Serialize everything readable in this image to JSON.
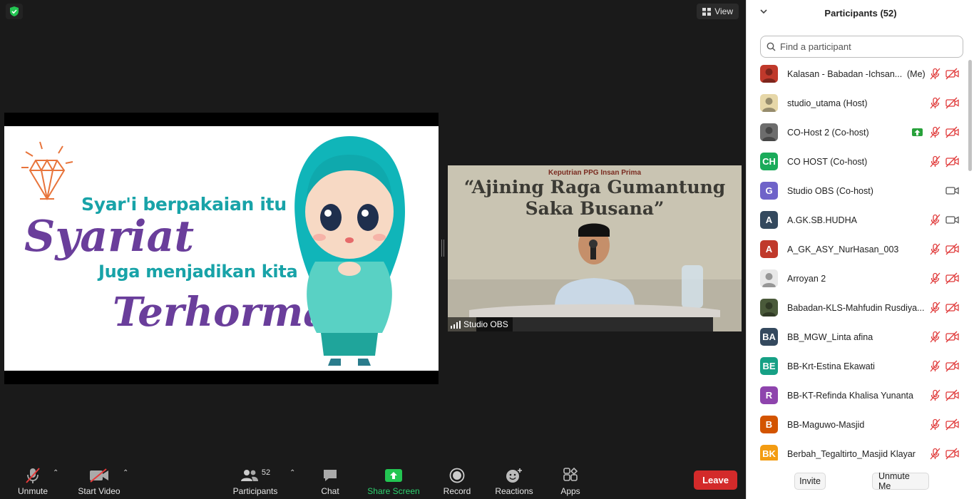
{
  "view_button": {
    "label": "View",
    "icon": "grid-icon"
  },
  "shared_slide": {
    "line1": "Syar'i berpakaian itu",
    "word1": "Syariat",
    "line2": "Juga menjadikan kita",
    "word2": "Terhormat"
  },
  "camera_tile": {
    "banner_small": "Keputrian PPG Insan Prima",
    "banner_line1": "“Ajining Raga Gumantung",
    "banner_line2": "Saka Busana”",
    "name": "Studio OBS"
  },
  "toolbar": {
    "unmute": "Unmute",
    "start_video": "Start Video",
    "participants": "Participants",
    "participants_count": "52",
    "chat": "Chat",
    "share_screen": "Share Screen",
    "record": "Record",
    "reactions": "Reactions",
    "apps": "Apps",
    "leave": "Leave"
  },
  "panel": {
    "title": "Participants (52)",
    "search_placeholder": "Find a participant",
    "invite": "Invite",
    "unmute_me": "Unmute Me",
    "participants": [
      {
        "name": "Kalasan - Babadan -Ichsan...",
        "me": "(Me)",
        "avatar": "",
        "color": "#c0392b",
        "photo": true,
        "mic": "muted",
        "video": "off"
      },
      {
        "name": "studio_utama (Host)",
        "avatar": "",
        "color": "#e6d7a8",
        "photo": true,
        "mic": "muted",
        "video": "off"
      },
      {
        "name": "CO-Host 2 (Co-host)",
        "avatar": "",
        "color": "#6d6d6d",
        "photo": true,
        "share": true,
        "mic": "muted",
        "video": "off"
      },
      {
        "name": "CO HOST (Co-host)",
        "avatar": "CH",
        "color": "#1aab5a",
        "mic": "muted",
        "video": "off"
      },
      {
        "name": "Studio OBS (Co-host)",
        "avatar": "G",
        "color": "#6f63c9",
        "mic": "none",
        "video": "on"
      },
      {
        "name": "A.GK.SB.HUDHA",
        "avatar": "A",
        "color": "#34495e",
        "mic": "muted",
        "video": "on"
      },
      {
        "name": "A_GK_ASY_NurHasan_003",
        "avatar": "A",
        "color": "#c0392b",
        "mic": "muted",
        "video": "off"
      },
      {
        "name": "Arroyan 2",
        "avatar": "",
        "color": "#e8e8e8",
        "photo": true,
        "mic": "muted",
        "video": "off"
      },
      {
        "name": "Babadan-KLS-Mahfudin Rusdiya...",
        "avatar": "",
        "color": "#4a5a3a",
        "photo": true,
        "mic": "muted",
        "video": "off"
      },
      {
        "name": "BB_MGW_Linta afina",
        "avatar": "BA",
        "color": "#34495e",
        "mic": "muted",
        "video": "off"
      },
      {
        "name": "BB-Krt-Estina Ekawati",
        "avatar": "BE",
        "color": "#16a085",
        "mic": "muted",
        "video": "off"
      },
      {
        "name": "BB-KT-Refinda Khalisa Yunanta",
        "avatar": "R",
        "color": "#8e44ad",
        "mic": "muted",
        "video": "off"
      },
      {
        "name": "BB-Maguwo-Masjid",
        "avatar": "B",
        "color": "#d35400",
        "mic": "muted",
        "video": "off"
      },
      {
        "name": "Berbah_Tegaltirto_Masjid Klayar",
        "avatar": "BK",
        "color": "#f39c12",
        "mic": "muted",
        "video": "off"
      }
    ]
  }
}
